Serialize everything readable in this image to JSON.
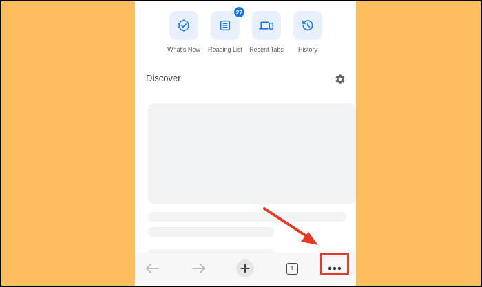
{
  "shortcuts": [
    {
      "label": "What's New",
      "icon": "badge-check-icon"
    },
    {
      "label": "Reading List",
      "icon": "reading-list-icon",
      "badge": "27"
    },
    {
      "label": "Recent Tabs",
      "icon": "devices-icon"
    },
    {
      "label": "History",
      "icon": "history-icon"
    }
  ],
  "discover": {
    "title": "Discover"
  },
  "toolbar": {
    "tab_count": "1"
  },
  "colors": {
    "background": "#FFBE5E",
    "accent": "#1A73E8",
    "tile": "#E8F0FB",
    "highlight": "#E53A25"
  }
}
